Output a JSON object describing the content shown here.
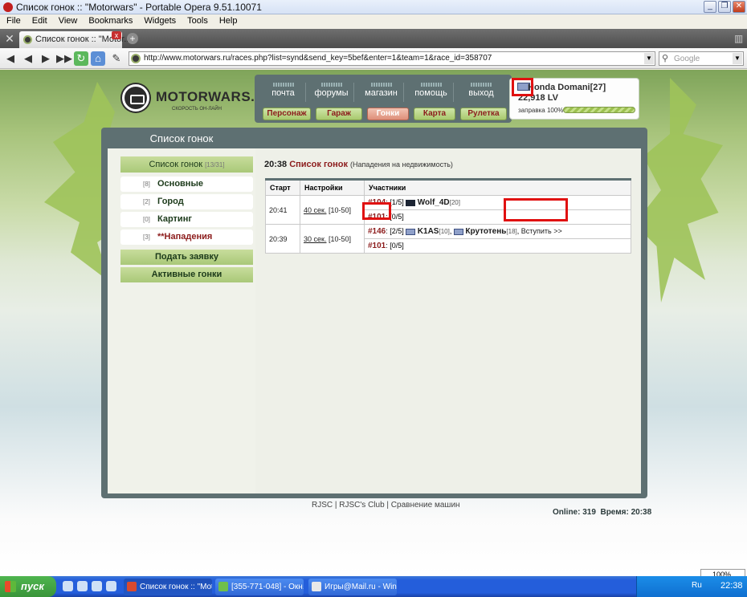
{
  "window": {
    "title": "Список гонок :: \"Motorwars\" - Portable Opera 9.51.10071"
  },
  "menu": [
    "File",
    "Edit",
    "View",
    "Bookmarks",
    "Widgets",
    "Tools",
    "Help"
  ],
  "tab": {
    "title": "Список гонок :: \"Motor..."
  },
  "address": {
    "url": "http://www.motorwars.ru/races.php?list=synd&send_key=5bef&enter=1&team=1&race_id=358707"
  },
  "search": {
    "placeholder": "Google"
  },
  "site": {
    "logo_name": "MOTORWARS.RU",
    "logo_sub": "СКОРОСТЬ ОН-ЛАЙН",
    "top_nav": [
      "почта",
      "форумы",
      "магазин",
      "помощь",
      "выход"
    ],
    "bottom_nav": [
      "Персонаж",
      "Гараж",
      "Гонки",
      "Карта",
      "Рулетка"
    ],
    "active_bottom": "Гонки",
    "user": {
      "name": "Honda Domani",
      "level": "[27]",
      "money": "22,918 LV",
      "fuel_label": "заправка 100%",
      "fuel_percent": 100
    },
    "sidebar": {
      "title": "Список гонок",
      "header": "Список гонок",
      "header_count": "[13/31]",
      "items": [
        {
          "count": "[8]",
          "label": "Основные"
        },
        {
          "count": "[2]",
          "label": "Город"
        },
        {
          "count": "[0]",
          "label": "Картинг"
        },
        {
          "count": "[3]",
          "label": "**Нападения"
        }
      ],
      "buttons": [
        "Подать заявку",
        "Активные гонки"
      ]
    },
    "main": {
      "time": "20:38",
      "title": "Список гонок",
      "subtitle": "(Нападения на недвижимость)",
      "columns": [
        "Старт",
        "Настройки",
        "Участники"
      ],
      "races": [
        {
          "start": "20:41",
          "setting_link": "40 сек.",
          "setting_range": "[10-50]",
          "lines": [
            {
              "id": "#104",
              "slots": ": [1/5]",
              "players": [
                {
                  "name": "Wolf_4D",
                  "level": "[20]",
                  "car": "dark"
                }
              ],
              "join": ""
            },
            {
              "id": "#101",
              "slots": ": [0/5]",
              "players": [],
              "join": ""
            }
          ]
        },
        {
          "start": "20:39",
          "setting_link": "30 сек.",
          "setting_range": "[10-50]",
          "lines": [
            {
              "id": "#146",
              "slots": ": [2/5]",
              "players": [
                {
                  "name": "K1AS",
                  "level": "[10]",
                  "car": "blue"
                },
                {
                  "name": "Крутотень",
                  "level": "[18]",
                  "car": "blue"
                }
              ],
              "join": "Вступить >>"
            },
            {
              "id": "#101",
              "slots": ": [0/5]",
              "players": [],
              "join": ""
            }
          ]
        }
      ]
    },
    "footer": {
      "links": "RJSC | RJSC's Club | Сравнение машин",
      "online": "Online: 319",
      "time": "Время: 20:38"
    }
  },
  "taskbar": {
    "start": "пуск",
    "tasks": [
      "Список гонок :: \"Mot...",
      "[355-771-048] - Окн...",
      "Игры@Mail.ru - Wind..."
    ],
    "lang": "Ru",
    "clock": "22:38",
    "zoom": "100%"
  }
}
